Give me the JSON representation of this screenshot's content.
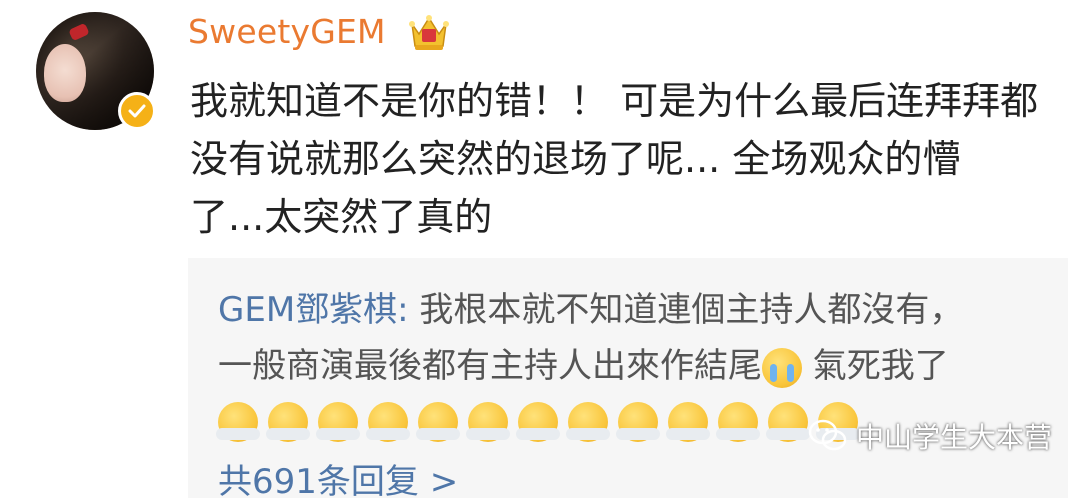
{
  "comment": {
    "username": "SweetyGEM",
    "lines": [
      "我就知道不是你的错！！ 可是为什么最后连拜拜都",
      "没有说就那么突然的退场了呢... 全场观众的懵",
      "了...太突然了真的"
    ]
  },
  "quote": {
    "author": "GEM鄧紫棋:",
    "line1": " 我根本就不知道連個主持人都沒有，",
    "line2_before": "一般商演最後都有主持人出來作結尾",
    "line2_after": " 氣死我了",
    "emoji_cry": "crying-face",
    "emoji_angry": "steam-face",
    "replies": "共691条回复 >"
  },
  "watermark": {
    "text": "中山学生大本营"
  },
  "colors": {
    "username": "#ea7a31",
    "link": "#4f76a8",
    "quote_bg": "#f6f6f6",
    "verified": "#f5b117"
  }
}
